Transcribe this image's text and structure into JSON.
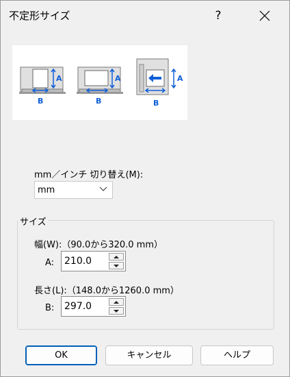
{
  "window": {
    "title": "不定形サイズ",
    "help_label": "?",
    "close_icon": "close-icon"
  },
  "unit": {
    "label": "mm／インチ 切り替え(M):",
    "selected": "mm"
  },
  "size_group": {
    "title": "サイズ",
    "width": {
      "label": "幅(W):（90.0から320.0 mm）",
      "field_label": "A:",
      "value": "210.0"
    },
    "length": {
      "label": "長さ(L):（148.0から1260.0 mm）",
      "field_label": "B:",
      "value": "297.0"
    }
  },
  "illustration": {
    "a_label": "A",
    "b_label": "B"
  },
  "buttons": {
    "ok": "OK",
    "cancel": "キャンセル",
    "help": "ヘルプ"
  },
  "colors": {
    "accent": "#005fb8",
    "arrow": "#0f5fd8"
  }
}
